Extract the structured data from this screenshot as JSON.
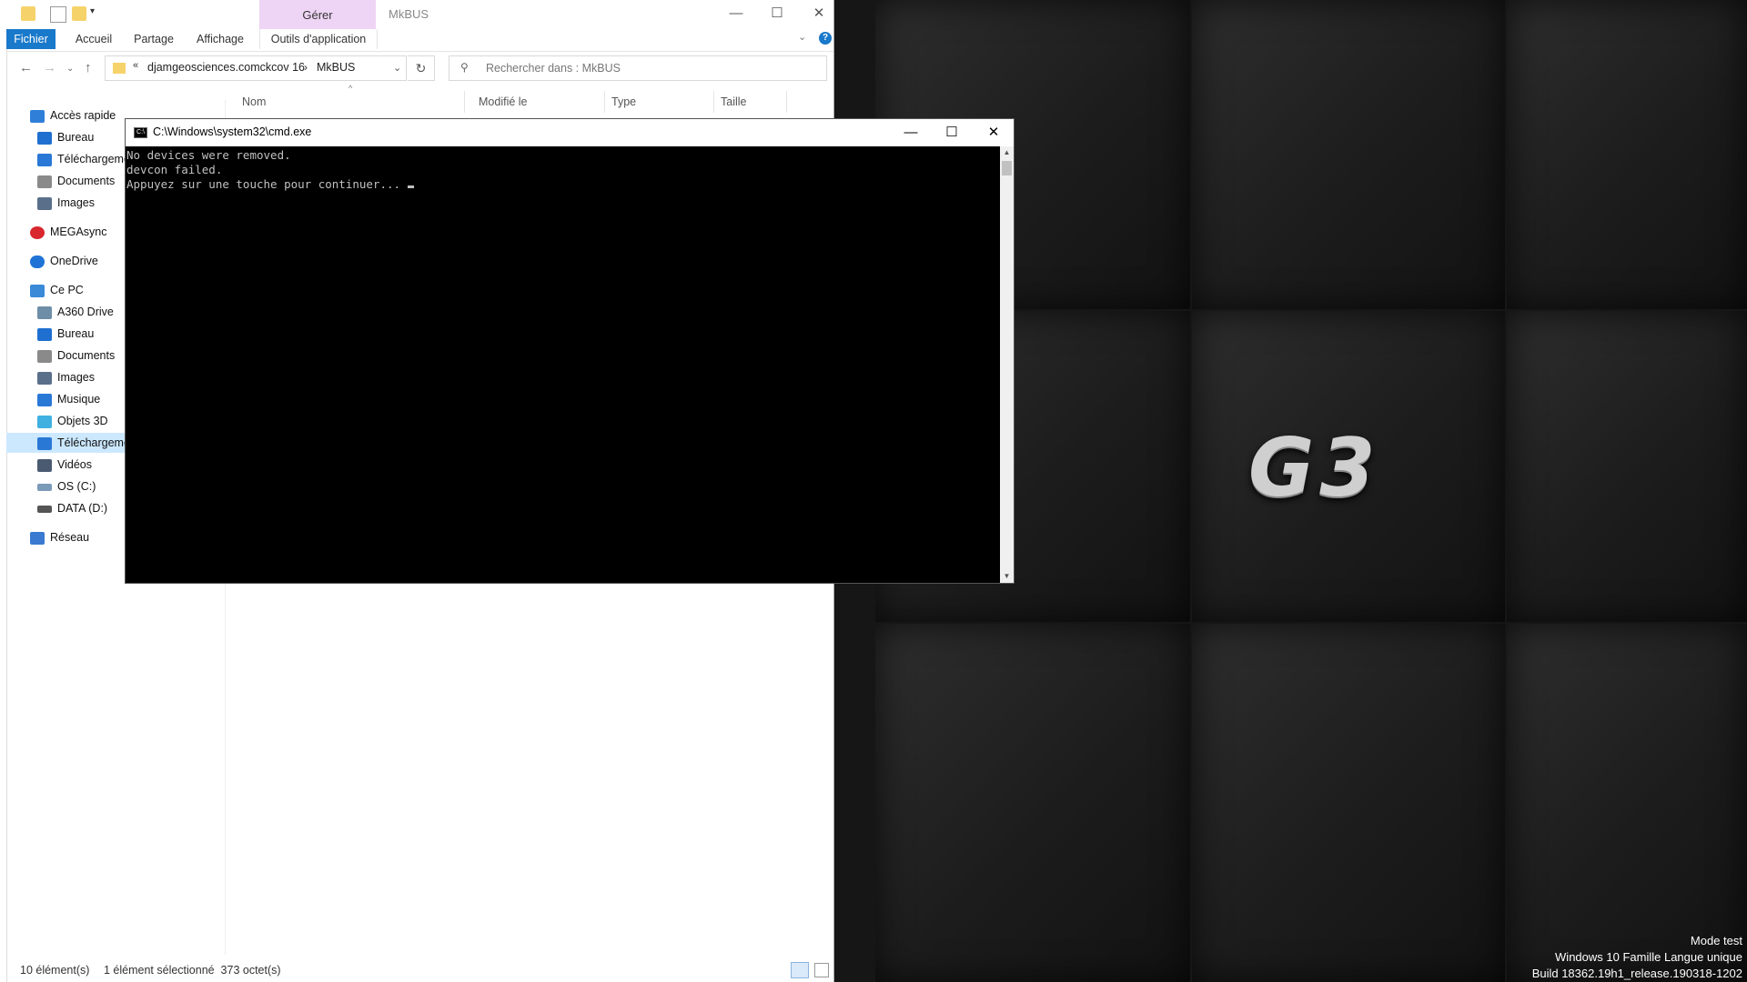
{
  "explorer": {
    "window_title": "MkBUS",
    "contextual_group": "Gérer",
    "ribbon_tabs": {
      "fichier": "Fichier",
      "accueil": "Accueil",
      "partage": "Partage",
      "affichage": "Affichage",
      "outils": "Outils d'application"
    },
    "address": {
      "chevron": "«",
      "part1": "djamgeosciences.comckcov 16",
      "separator": "›",
      "part2": "MkBUS"
    },
    "search_placeholder": "Rechercher dans : MkBUS",
    "columns": {
      "nom": "Nom",
      "modifie": "Modifié le",
      "type": "Type",
      "taille": "Taille"
    },
    "nav": [
      {
        "label": "Accès rapide",
        "icon": "star-icon",
        "color": "#2f7fd8"
      },
      {
        "label": "Bureau",
        "icon": "desktop-icon",
        "color": "#1f6fd0"
      },
      {
        "label": "Téléchargements",
        "icon": "download-icon",
        "color": "#2a78d6"
      },
      {
        "label": "Documents",
        "icon": "document-icon",
        "color": "#8a8a8a"
      },
      {
        "label": "Images",
        "icon": "image-icon",
        "color": "#5a6f8a"
      },
      {
        "label": "MEGAsync",
        "icon": "mega-icon",
        "color": "#d9272e"
      },
      {
        "label": "OneDrive",
        "icon": "cloud-icon",
        "color": "#1f73d6"
      },
      {
        "label": "Ce PC",
        "icon": "computer-icon",
        "color": "#3a8ad8"
      },
      {
        "label": "A360 Drive",
        "icon": "drive-icon",
        "color": "#6e8ea8"
      },
      {
        "label": "Bureau",
        "icon": "desktop-icon",
        "color": "#1f6fd0"
      },
      {
        "label": "Documents",
        "icon": "document-icon",
        "color": "#8a8a8a"
      },
      {
        "label": "Images",
        "icon": "image-icon",
        "color": "#5a6f8a"
      },
      {
        "label": "Musique",
        "icon": "music-icon",
        "color": "#2a78d6"
      },
      {
        "label": "Objets 3D",
        "icon": "cube-icon",
        "color": "#3fb0e0"
      },
      {
        "label": "Téléchargements",
        "icon": "download-icon",
        "color": "#2a78d6"
      },
      {
        "label": "Vidéos",
        "icon": "video-icon",
        "color": "#4a5a70"
      },
      {
        "label": "OS (C:)",
        "icon": "disk-icon",
        "color": "#7a9ab8"
      },
      {
        "label": "DATA (D:)",
        "icon": "disk-icon",
        "color": "#555555"
      },
      {
        "label": "Réseau",
        "icon": "network-icon",
        "color": "#3a7ad0"
      }
    ],
    "status": {
      "count": "10 élément(s)",
      "selection": "1 élément sélectionné  373 octet(s)"
    }
  },
  "cmd": {
    "title": "C:\\Windows\\system32\\cmd.exe",
    "icon_label": "C:\\",
    "lines": [
      "No devices were removed.",
      "devcon failed.",
      "Appuyez sur une touche pour continuer..."
    ]
  },
  "desktop": {
    "logo": "G3",
    "watermark": [
      "Mode test",
      "Windows 10 Famille Langue unique",
      "Build 18362.19h1_release.190318-1202"
    ]
  }
}
